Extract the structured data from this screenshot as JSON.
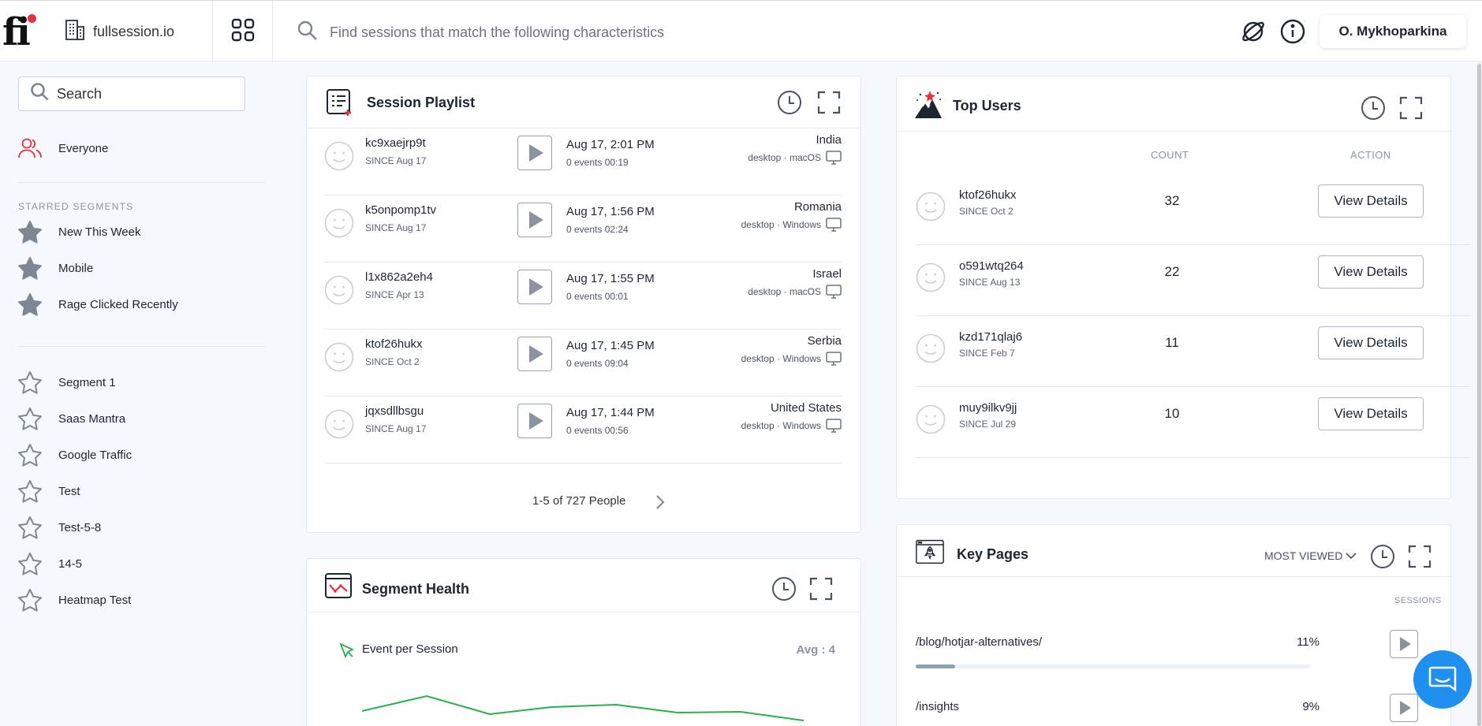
{
  "topbar": {
    "logo_text": "fi",
    "site_name": "fullsession.io",
    "search_placeholder": "Find sessions that match the following characteristics",
    "user_name": "O. Mykhoparkina"
  },
  "sidebar": {
    "search_placeholder": "Search",
    "everyone_label": "Everyone",
    "starred_heading": "STARRED SEGMENTS",
    "starred": [
      {
        "label": "New This Week"
      },
      {
        "label": "Mobile"
      },
      {
        "label": "Rage Clicked Recently"
      }
    ],
    "segments": [
      {
        "label": "Segment 1"
      },
      {
        "label": "Saas Mantra"
      },
      {
        "label": "Google Traffic"
      },
      {
        "label": "Test"
      },
      {
        "label": "Test-5-8"
      },
      {
        "label": "14-5"
      },
      {
        "label": "Heatmap Test"
      }
    ]
  },
  "session_playlist": {
    "title": "Session Playlist",
    "rows": [
      {
        "id": "kc9xaejrp9t",
        "since": "SINCE Aug 17",
        "when": "Aug 17, 2:01 PM",
        "events": "0 events  00:19",
        "country": "India",
        "device": "desktop · macOS"
      },
      {
        "id": "k5onpomp1tv",
        "since": "SINCE Aug 17",
        "when": "Aug 17, 1:56 PM",
        "events": "0 events  02:24",
        "country": "Romania",
        "device": "desktop · Windows"
      },
      {
        "id": "l1x862a2eh4",
        "since": "SINCE Apr 13",
        "when": "Aug 17, 1:55 PM",
        "events": "0 events  00:01",
        "country": "Israel",
        "device": "desktop · macOS"
      },
      {
        "id": "ktof26hukx",
        "since": "SINCE Oct 2",
        "when": "Aug 17, 1:45 PM",
        "events": "0 events  09:04",
        "country": "Serbia",
        "device": "desktop · Windows"
      },
      {
        "id": "jqxsdllbsgu",
        "since": "SINCE Aug 17",
        "when": "Aug 17, 1:44 PM",
        "events": "0 events  00:56",
        "country": "United States",
        "device": "desktop · Windows"
      }
    ],
    "pager": "1-5 of 727 People"
  },
  "segment_health": {
    "title": "Segment Health",
    "metric_label": "Event per Session",
    "avg": "Avg : 4",
    "line_color": "#22b34a"
  },
  "top_users": {
    "title": "Top Users",
    "col_count": "COUNT",
    "col_action": "ACTION",
    "rows": [
      {
        "id": "ktof26hukx",
        "since": "SINCE Oct 2",
        "count": "32",
        "action": "View Details"
      },
      {
        "id": "o591wtq264",
        "since": "SINCE Aug 13",
        "count": "22",
        "action": "View Details"
      },
      {
        "id": "kzd171qlaj6",
        "since": "SINCE Feb 7",
        "count": "11",
        "action": "View Details"
      },
      {
        "id": "muy9ilkv9jj",
        "since": "SINCE Jul 29",
        "count": "10",
        "action": "View Details"
      }
    ]
  },
  "key_pages": {
    "title": "Key Pages",
    "sort": "MOST VIEWED",
    "col_sessions": "SESSIONS",
    "rows": [
      {
        "path": "/blog/hotjar-alternatives/",
        "pct": "11%",
        "share": 0.11
      },
      {
        "path": "/insights",
        "pct": "9%",
        "share": 0.09
      }
    ]
  },
  "colors": {
    "accent": "#e5323b",
    "chat": "#1f8ff0",
    "text": "#1e2532"
  }
}
